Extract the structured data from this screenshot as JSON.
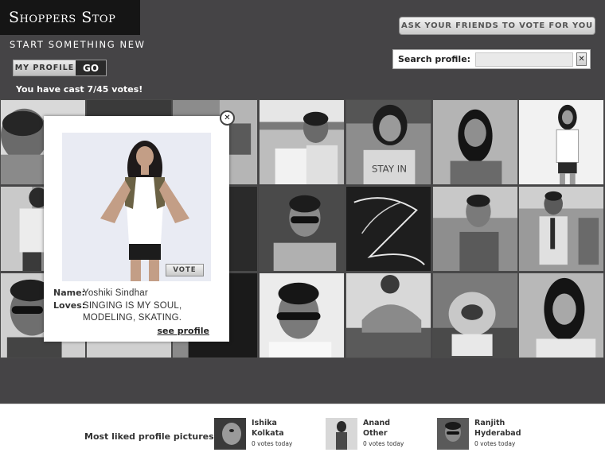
{
  "header": {
    "logo_text": "Shoppers Stop",
    "tagline": "START SOMETHING NEW",
    "my_profile_label": "MY PROFILE",
    "go_label": "GO",
    "votes_status": "You have cast 7/45 votes!",
    "ask_friends_label": "ASK YOUR FRIENDS TO VOTE FOR YOU"
  },
  "search": {
    "label": "Search profile:",
    "value": "",
    "clear_label": "✕"
  },
  "popup": {
    "close_label": "✕",
    "vote_label": "VOTE",
    "name_key": "Name:",
    "name_value": "Yoshiki Sindhar",
    "loves_key": "Loves:",
    "loves_line1": "SINGING IS MY SOUL,",
    "loves_line2": "MODELING, SKATING.",
    "see_profile_label": "see profile"
  },
  "grid": {
    "colors": [
      "#2c2c2c",
      "#9a9a9a",
      "#d8d8d8",
      "#f2f2f2"
    ]
  },
  "most_liked": {
    "label": "Most liked profile pictures:",
    "items": [
      {
        "name": "Ishika",
        "city": "Kolkata",
        "votes": "0 votes today"
      },
      {
        "name": "Anand",
        "city": "Other",
        "votes": "0 votes today"
      },
      {
        "name": "Ranjith",
        "city": "Hyderabad",
        "votes": "0 votes today"
      }
    ]
  }
}
